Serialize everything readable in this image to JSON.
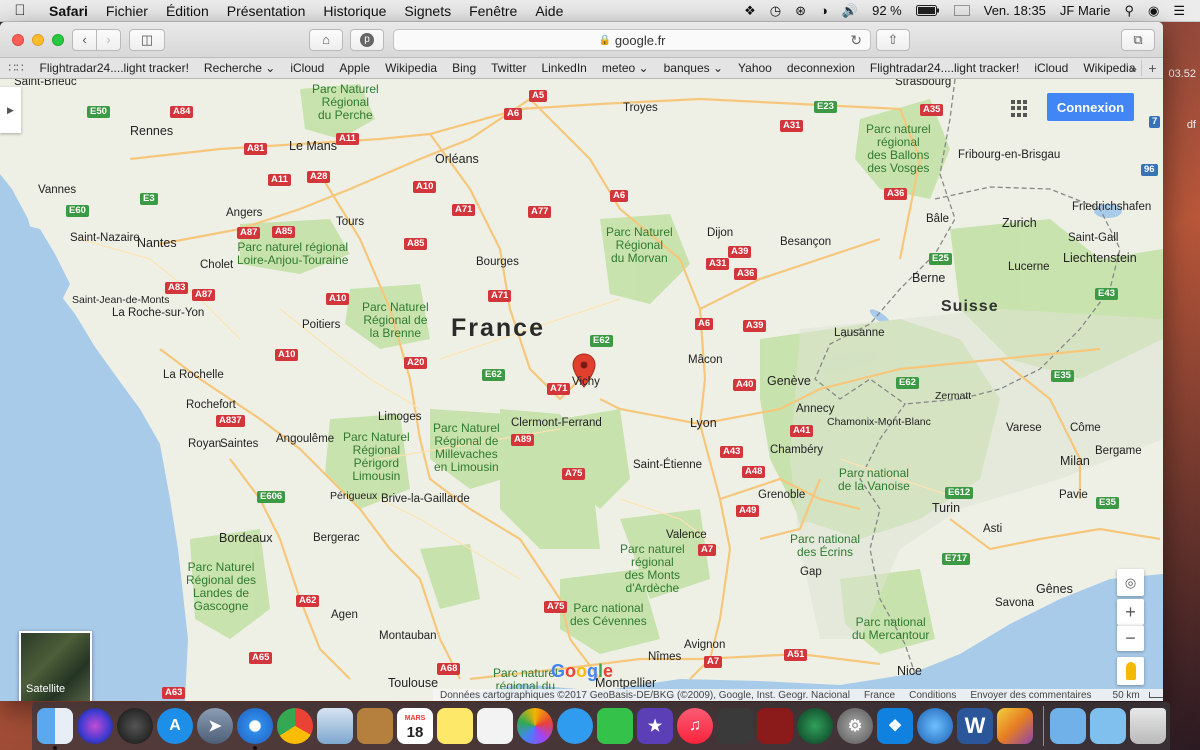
{
  "menubar": {
    "apple_icon": "apple-logo-icon",
    "app_name": "Safari",
    "menus": [
      "Fichier",
      "Édition",
      "Présentation",
      "Historique",
      "Signets",
      "Fenêtre",
      "Aide"
    ],
    "battery": "92 %",
    "datetime": "Ven. 18:35",
    "user": "JF Marie"
  },
  "browser": {
    "url": "google.fr",
    "bookmarks": [
      "Flightradar24....light tracker!",
      "Recherche ⌄",
      "iCloud",
      "Apple",
      "Wikipedia",
      "Bing",
      "Twitter",
      "LinkedIn",
      "meteo ⌄",
      "banques ⌄",
      "Yahoo",
      "deconnexion",
      "Flightradar24....light tracker!",
      "iCloud",
      "Wikipedia"
    ],
    "more_label": "»",
    "new_tab_label": "+"
  },
  "map": {
    "countries": {
      "france": "France",
      "suisse": "Suisse"
    },
    "marker_city": "Vichy",
    "cities": {
      "saint_brieuc": "Saint-Brieuc",
      "rennes": "Rennes",
      "le_mans": "Le Mans",
      "orleans": "Orléans",
      "troyes": "Troyes",
      "strasbourg": "Strasbourg",
      "fribourg": "Fribourg-en-Brisgau",
      "vannes": "Vannes",
      "angers": "Angers",
      "tours": "Tours",
      "nantes": "Nantes",
      "saint_nazaire": "Saint-Nazaire",
      "cholet": "Cholet",
      "bourges": "Bourges",
      "dijon": "Dijon",
      "besancon": "Besançon",
      "bale": "Bâle",
      "zurich": "Zurich",
      "friedrichshafen": "Friedrichshafen",
      "saint_gall": "Saint-Gall",
      "liechtenstein": "Liechtenstein",
      "saint_jean": "Saint-Jean-de-Monts",
      "roche_yon": "La Roche-sur-Yon",
      "poitiers": "Poitiers",
      "berne": "Berne",
      "lucerne": "Lucerne",
      "la_rochelle": "La Rochelle",
      "macon": "Mâcon",
      "lausanne": "Lausanne",
      "rochefort": "Rochefort",
      "limoges": "Limoges",
      "geneve": "Genève",
      "annecy": "Annecy",
      "zermatt": "Zermatt",
      "royan": "Royan",
      "saintes": "Saintes",
      "angouleme": "Angoulême",
      "clermont": "Clermont-Ferrand",
      "lyon": "Lyon",
      "chamonix": "Chamonix-Mont-Blanc",
      "varese": "Varese",
      "come": "Côme",
      "chambery": "Chambéry",
      "saint_etienne": "Saint-Étienne",
      "milan": "Milan",
      "bergame": "Bergame",
      "perigueux": "Périgueux",
      "brive": "Brive-la-Gaillarde",
      "grenoble": "Grenoble",
      "turin": "Turin",
      "pavie": "Pavie",
      "bordeaux": "Bordeaux",
      "bergerac": "Bergerac",
      "valence": "Valence",
      "asti": "Asti",
      "gap": "Gap",
      "genes": "Gênes",
      "savona": "Savona",
      "agen": "Agen",
      "montauban": "Montauban",
      "nimes": "Nîmes",
      "avignon": "Avignon",
      "toulouse": "Toulouse",
      "montpellier": "Montpellier",
      "nice": "Nice"
    },
    "parks": {
      "perche": "Parc Naturel\nRégional\ndu Perche",
      "ballons": "Parc naturel\nrégional\ndes Ballons\ndes Vosges",
      "loire_anjou": "Parc naturel régional\nLoire-Anjou-Touraine",
      "morvan": "Parc Naturel\nRégional\ndu Morvan",
      "brenne": "Parc Naturel\nRégional de\nla Brenne",
      "perigord": "Parc Naturel\nRégional\nPérigord\nLimousin",
      "millevaches": "Parc Naturel\nRégional de\nMillevaches\nen Limousin",
      "vanoise": "Parc national\nde la Vanoise",
      "ecrins": "Parc national\ndes Écrins",
      "ardeche": "Parc naturel\nrégional\ndes Monts\nd'Ardèche",
      "landes": "Parc Naturel\nRégional des\nLandes de\nGascogne",
      "cevennes": "Parc national\ndes Cévennes",
      "mercantour": "Parc national\ndu Mercantour",
      "languedoc": "Parc naturel\nrégional du"
    },
    "roads": {
      "a84": "A84",
      "a81": "A81",
      "a11": "A11",
      "a28": "A28",
      "a10": "A10",
      "a10b": "A10",
      "a10c": "A10",
      "a71": "A71",
      "a71b": "A71",
      "a71c": "A71",
      "a77": "A77",
      "a6": "A6",
      "a6b": "A6",
      "a6c": "A6",
      "a5": "A5",
      "a31": "A31",
      "a31b": "A31",
      "a35": "A35",
      "a36": "A36",
      "a39": "A39",
      "a39b": "A39",
      "a87": "A87",
      "a85": "A85",
      "a83": "A83",
      "a87b": "A87",
      "a20": "A20",
      "a837": "A837",
      "a89": "A89",
      "a75": "A75",
      "a75b": "A75",
      "a43": "A43",
      "a48": "A48",
      "a41": "A41",
      "a49": "A49",
      "a7": "A7",
      "a7b": "A7",
      "a40": "A40",
      "a62": "A62",
      "a65": "A65",
      "a68": "A68",
      "a63": "A63",
      "a51": "A51",
      "e50": "E50",
      "e3": "E3",
      "e60": "E60",
      "e23": "E23",
      "e25": "E25",
      "e62": "E62",
      "e62b": "E62",
      "e62c": "E62",
      "e43": "E43",
      "e35": "E35",
      "e35b": "E35",
      "e612": "E612",
      "e717": "E717",
      "e606": "E606",
      "n7": "7",
      "n96": "96"
    },
    "signin_label": "Connexion",
    "satellite_label": "Satellite",
    "zoom_in": "+",
    "zoom_out": "−",
    "google_logo": "Google",
    "footer": {
      "attribution": "Données cartographiques ©2017 GeoBasis-DE/BKG (©2009), Google, Inst. Geogr. Nacional",
      "region": "France",
      "terms": "Conditions",
      "feedback": "Envoyer des commentaires",
      "scale": "50 km"
    }
  },
  "dock": {
    "calendar_day": "18",
    "calendar_month": "MARS"
  },
  "desktop": {
    "clipped_time": "03.52",
    "clipped_text": "df"
  },
  "colors": {
    "water": "#a8cbe9",
    "land": "#eef0e6",
    "forest": "#c6e2ab",
    "motorway": "#f6c77b",
    "route_red": "#d2353a",
    "euroroute_green": "#3d9a44",
    "accent_blue": "#4285f4",
    "marker_red": "#e2402f"
  }
}
